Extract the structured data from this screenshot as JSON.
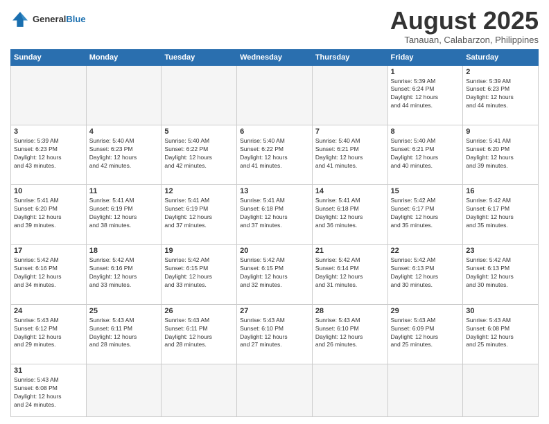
{
  "header": {
    "logo_general": "General",
    "logo_blue": "Blue",
    "month_title": "August 2025",
    "location": "Tanauan, Calabarzon, Philippines"
  },
  "weekdays": [
    "Sunday",
    "Monday",
    "Tuesday",
    "Wednesday",
    "Thursday",
    "Friday",
    "Saturday"
  ],
  "weeks": [
    [
      {
        "day": "",
        "info": ""
      },
      {
        "day": "",
        "info": ""
      },
      {
        "day": "",
        "info": ""
      },
      {
        "day": "",
        "info": ""
      },
      {
        "day": "",
        "info": ""
      },
      {
        "day": "1",
        "info": "Sunrise: 5:39 AM\nSunset: 6:24 PM\nDaylight: 12 hours\nand 44 minutes."
      },
      {
        "day": "2",
        "info": "Sunrise: 5:39 AM\nSunset: 6:23 PM\nDaylight: 12 hours\nand 44 minutes."
      }
    ],
    [
      {
        "day": "3",
        "info": "Sunrise: 5:39 AM\nSunset: 6:23 PM\nDaylight: 12 hours\nand 43 minutes."
      },
      {
        "day": "4",
        "info": "Sunrise: 5:40 AM\nSunset: 6:23 PM\nDaylight: 12 hours\nand 42 minutes."
      },
      {
        "day": "5",
        "info": "Sunrise: 5:40 AM\nSunset: 6:22 PM\nDaylight: 12 hours\nand 42 minutes."
      },
      {
        "day": "6",
        "info": "Sunrise: 5:40 AM\nSunset: 6:22 PM\nDaylight: 12 hours\nand 41 minutes."
      },
      {
        "day": "7",
        "info": "Sunrise: 5:40 AM\nSunset: 6:21 PM\nDaylight: 12 hours\nand 41 minutes."
      },
      {
        "day": "8",
        "info": "Sunrise: 5:40 AM\nSunset: 6:21 PM\nDaylight: 12 hours\nand 40 minutes."
      },
      {
        "day": "9",
        "info": "Sunrise: 5:41 AM\nSunset: 6:20 PM\nDaylight: 12 hours\nand 39 minutes."
      }
    ],
    [
      {
        "day": "10",
        "info": "Sunrise: 5:41 AM\nSunset: 6:20 PM\nDaylight: 12 hours\nand 39 minutes."
      },
      {
        "day": "11",
        "info": "Sunrise: 5:41 AM\nSunset: 6:19 PM\nDaylight: 12 hours\nand 38 minutes."
      },
      {
        "day": "12",
        "info": "Sunrise: 5:41 AM\nSunset: 6:19 PM\nDaylight: 12 hours\nand 37 minutes."
      },
      {
        "day": "13",
        "info": "Sunrise: 5:41 AM\nSunset: 6:18 PM\nDaylight: 12 hours\nand 37 minutes."
      },
      {
        "day": "14",
        "info": "Sunrise: 5:41 AM\nSunset: 6:18 PM\nDaylight: 12 hours\nand 36 minutes."
      },
      {
        "day": "15",
        "info": "Sunrise: 5:42 AM\nSunset: 6:17 PM\nDaylight: 12 hours\nand 35 minutes."
      },
      {
        "day": "16",
        "info": "Sunrise: 5:42 AM\nSunset: 6:17 PM\nDaylight: 12 hours\nand 35 minutes."
      }
    ],
    [
      {
        "day": "17",
        "info": "Sunrise: 5:42 AM\nSunset: 6:16 PM\nDaylight: 12 hours\nand 34 minutes."
      },
      {
        "day": "18",
        "info": "Sunrise: 5:42 AM\nSunset: 6:16 PM\nDaylight: 12 hours\nand 33 minutes."
      },
      {
        "day": "19",
        "info": "Sunrise: 5:42 AM\nSunset: 6:15 PM\nDaylight: 12 hours\nand 33 minutes."
      },
      {
        "day": "20",
        "info": "Sunrise: 5:42 AM\nSunset: 6:15 PM\nDaylight: 12 hours\nand 32 minutes."
      },
      {
        "day": "21",
        "info": "Sunrise: 5:42 AM\nSunset: 6:14 PM\nDaylight: 12 hours\nand 31 minutes."
      },
      {
        "day": "22",
        "info": "Sunrise: 5:42 AM\nSunset: 6:13 PM\nDaylight: 12 hours\nand 30 minutes."
      },
      {
        "day": "23",
        "info": "Sunrise: 5:42 AM\nSunset: 6:13 PM\nDaylight: 12 hours\nand 30 minutes."
      }
    ],
    [
      {
        "day": "24",
        "info": "Sunrise: 5:43 AM\nSunset: 6:12 PM\nDaylight: 12 hours\nand 29 minutes."
      },
      {
        "day": "25",
        "info": "Sunrise: 5:43 AM\nSunset: 6:11 PM\nDaylight: 12 hours\nand 28 minutes."
      },
      {
        "day": "26",
        "info": "Sunrise: 5:43 AM\nSunset: 6:11 PM\nDaylight: 12 hours\nand 28 minutes."
      },
      {
        "day": "27",
        "info": "Sunrise: 5:43 AM\nSunset: 6:10 PM\nDaylight: 12 hours\nand 27 minutes."
      },
      {
        "day": "28",
        "info": "Sunrise: 5:43 AM\nSunset: 6:10 PM\nDaylight: 12 hours\nand 26 minutes."
      },
      {
        "day": "29",
        "info": "Sunrise: 5:43 AM\nSunset: 6:09 PM\nDaylight: 12 hours\nand 25 minutes."
      },
      {
        "day": "30",
        "info": "Sunrise: 5:43 AM\nSunset: 6:08 PM\nDaylight: 12 hours\nand 25 minutes."
      }
    ],
    [
      {
        "day": "31",
        "info": "Sunrise: 5:43 AM\nSunset: 6:08 PM\nDaylight: 12 hours\nand 24 minutes."
      },
      {
        "day": "",
        "info": ""
      },
      {
        "day": "",
        "info": ""
      },
      {
        "day": "",
        "info": ""
      },
      {
        "day": "",
        "info": ""
      },
      {
        "day": "",
        "info": ""
      },
      {
        "day": "",
        "info": ""
      }
    ]
  ]
}
